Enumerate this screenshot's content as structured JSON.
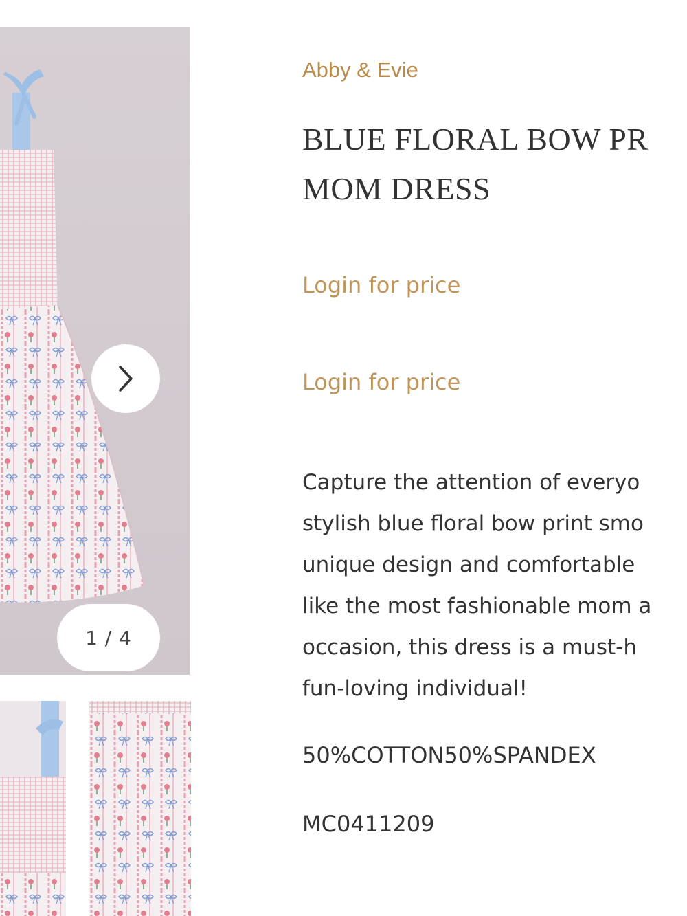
{
  "product": {
    "brand": "Abby & Evie",
    "title_lines": [
      "BLUE FLORAL BOW PR",
      "MOM DRESS"
    ],
    "price_labels": [
      "Login for price",
      "Login for price"
    ],
    "description_lines": [
      "Capture the attention of everyo",
      "stylish blue floral bow print smo",
      "unique design and comfortable",
      "like the most fashionable mom a",
      "occasion, this dress is a must-h",
      "fun-loving individual!"
    ],
    "material": "50%COTTON50%SPANDEX",
    "sku": "MC0411209"
  },
  "gallery": {
    "counter": "1 / 4",
    "next_icon": "chevron-right-icon",
    "thumbnail_count": 2
  },
  "colors": {
    "brand": "#b98a4a",
    "price": "#c0955a",
    "text": "#333333",
    "photo_background": "#d4ccd1",
    "dress_pink": "#e39aa6",
    "dress_blue": "#7f9fd2",
    "strap_blue": "#a9c7e8"
  }
}
